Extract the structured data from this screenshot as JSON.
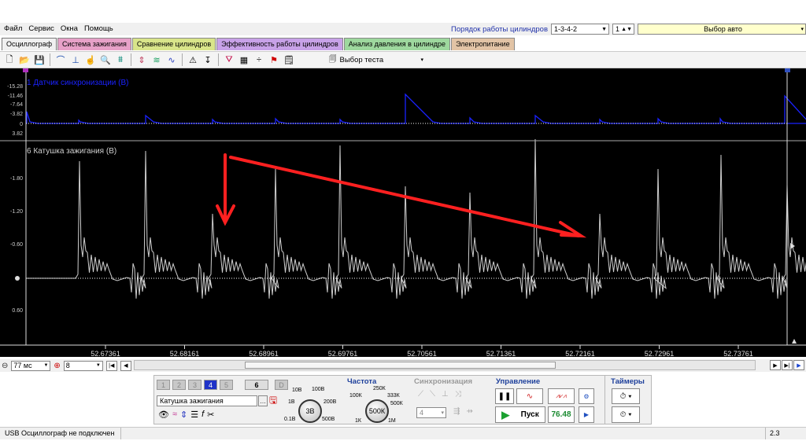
{
  "menu": [
    "Файл",
    "Сервис",
    "Окна",
    "Помощь"
  ],
  "header": {
    "cylinder_order_label": "Порядок работы цилиндров",
    "cylinder_order_value": "1-3-4-2",
    "cylinder_number": "1",
    "car_select": "Выбор авто"
  },
  "tabs": [
    {
      "label": "Осциллограф",
      "color": "#f0f0f0"
    },
    {
      "label": "Система зажигания",
      "color": "#e7a1c8"
    },
    {
      "label": "Сравнение цилиндров",
      "color": "#d9e58a"
    },
    {
      "label": "Эффективность работы цилиндров",
      "color": "#c8a2e8"
    },
    {
      "label": "Анализ давления в цилиндре",
      "color": "#9ed89e"
    },
    {
      "label": "Электропитание",
      "color": "#e2c4a6"
    }
  ],
  "toolbar": {
    "test_select": "Выбор теста"
  },
  "scope": {
    "channel1_label": "1 Датчик синхронизации (В)",
    "channel6_label": "6 Катушка зажигания (В)",
    "top_ticks": [
      "-15.28",
      "-11.46",
      "-7.64",
      "-3.82",
      "0",
      "3.82"
    ],
    "main_ticks": [
      "-1.80",
      "-1.20",
      "-0.60",
      "0.60"
    ],
    "time_ticks": [
      "52.67361",
      "52.68161",
      "52.68961",
      "52.69761",
      "52.70561",
      "52.71361",
      "52.72161",
      "52.72961",
      "52.73761"
    ]
  },
  "bottom": {
    "timebase": "77 мс",
    "scale": "8"
  },
  "controls": {
    "channel_buttons": [
      "1",
      "2",
      "3",
      "4",
      "5",
      "6",
      "D"
    ],
    "channel_select": "Катушка зажигания",
    "voltage_labels": [
      "10В",
      "100В",
      "1В",
      "200В",
      "0.1В",
      "500В"
    ],
    "voltage_value": "3В",
    "freq_title": "Частота",
    "freq_labels": [
      "250К",
      "100К",
      "333К",
      "500К",
      "1К",
      "1М"
    ],
    "freq_value": "500К",
    "sync_title": "Синхронизация",
    "sync_value": "4",
    "control_title": "Управление",
    "start_label": "Пуск",
    "rpm_value": "76.48",
    "timers_title": "Таймеры"
  },
  "status": {
    "left": "USB Осциллограф не подключен",
    "right": "2.3"
  },
  "colors": {
    "sync_trace": "#1a22ff",
    "coil_trace": "#cfcfcf",
    "annotation": "#ff2020"
  }
}
